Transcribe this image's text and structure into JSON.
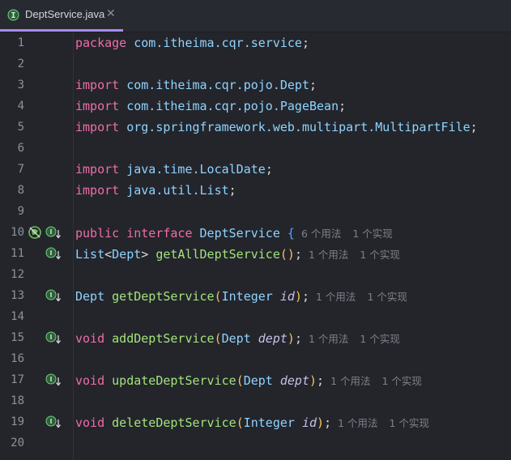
{
  "tab": {
    "title": "DeptService.java",
    "icon": "interface-file-icon",
    "accent": "#a78bfa"
  },
  "colors": {
    "keyword": "#f06ca8",
    "identifier": "#8fd3ff",
    "method": "#a3e37a",
    "paren": "#f5c45c",
    "brace": "#5aa2ff",
    "param": "#c9bfe8",
    "hint": "#7d8089"
  },
  "line_numbers": [
    "1",
    "2",
    "3",
    "4",
    "5",
    "6",
    "7",
    "8",
    "9",
    "10",
    "11",
    "12",
    "13",
    "14",
    "15",
    "16",
    "17",
    "18",
    "19",
    "20"
  ],
  "code": {
    "l1": {
      "kw": "package",
      "pkg": "com.itheima.cqr.service",
      "semi": ";"
    },
    "l3": {
      "kw": "import",
      "pkg": "com.itheima.cqr.pojo.Dept",
      "semi": ";"
    },
    "l4": {
      "kw": "import",
      "pkg": "com.itheima.cqr.pojo.PageBean",
      "semi": ";"
    },
    "l5": {
      "kw": "import",
      "pkg": "org.springframework.web.multipart.MultipartFile",
      "semi": ";"
    },
    "l7": {
      "kw": "import",
      "pkg": "java.time.LocalDate",
      "semi": ";"
    },
    "l8": {
      "kw": "import",
      "pkg": "java.util.List",
      "semi": ";"
    },
    "l10": {
      "kw1": "public",
      "kw2": "interface",
      "name": "DeptService",
      "brace": "{",
      "hint_usages": "6 个用法",
      "hint_impl": "1 个实现"
    },
    "l11": {
      "type": "List",
      "lt": "<",
      "generic": "Dept",
      "gt": ">",
      "method": "getAllDeptService",
      "parens": "()",
      "semi": ";",
      "hint_usages": "1 个用法",
      "hint_impl": "1 个实现"
    },
    "l13": {
      "type": "Dept",
      "method": "getDeptService",
      "lp": "(",
      "ptype": "Integer",
      "pname": "id",
      "rp": ")",
      "semi": ";",
      "hint_usages": "1 个用法",
      "hint_impl": "1 个实现"
    },
    "l15": {
      "type": "void",
      "method": "addDeptService",
      "lp": "(",
      "ptype": "Dept",
      "pname": "dept",
      "rp": ")",
      "semi": ";",
      "hint_usages": "1 个用法",
      "hint_impl": "1 个实现"
    },
    "l17": {
      "type": "void",
      "method": "updateDeptService",
      "lp": "(",
      "ptype": "Dept",
      "pname": "dept",
      "rp": ")",
      "semi": ";",
      "hint_usages": "1 个用法",
      "hint_impl": "1 个实现"
    },
    "l19": {
      "type": "void",
      "method": "deleteDeptService",
      "lp": "(",
      "ptype": "Integer",
      "pname": "id",
      "rp": ")",
      "semi": ";",
      "hint_usages": "1 个用法",
      "hint_impl": "1 个实现"
    }
  },
  "gutter_icons": {
    "no_bean": "spring-no-bean-icon",
    "impl": "implemented-down-arrow-icon"
  }
}
